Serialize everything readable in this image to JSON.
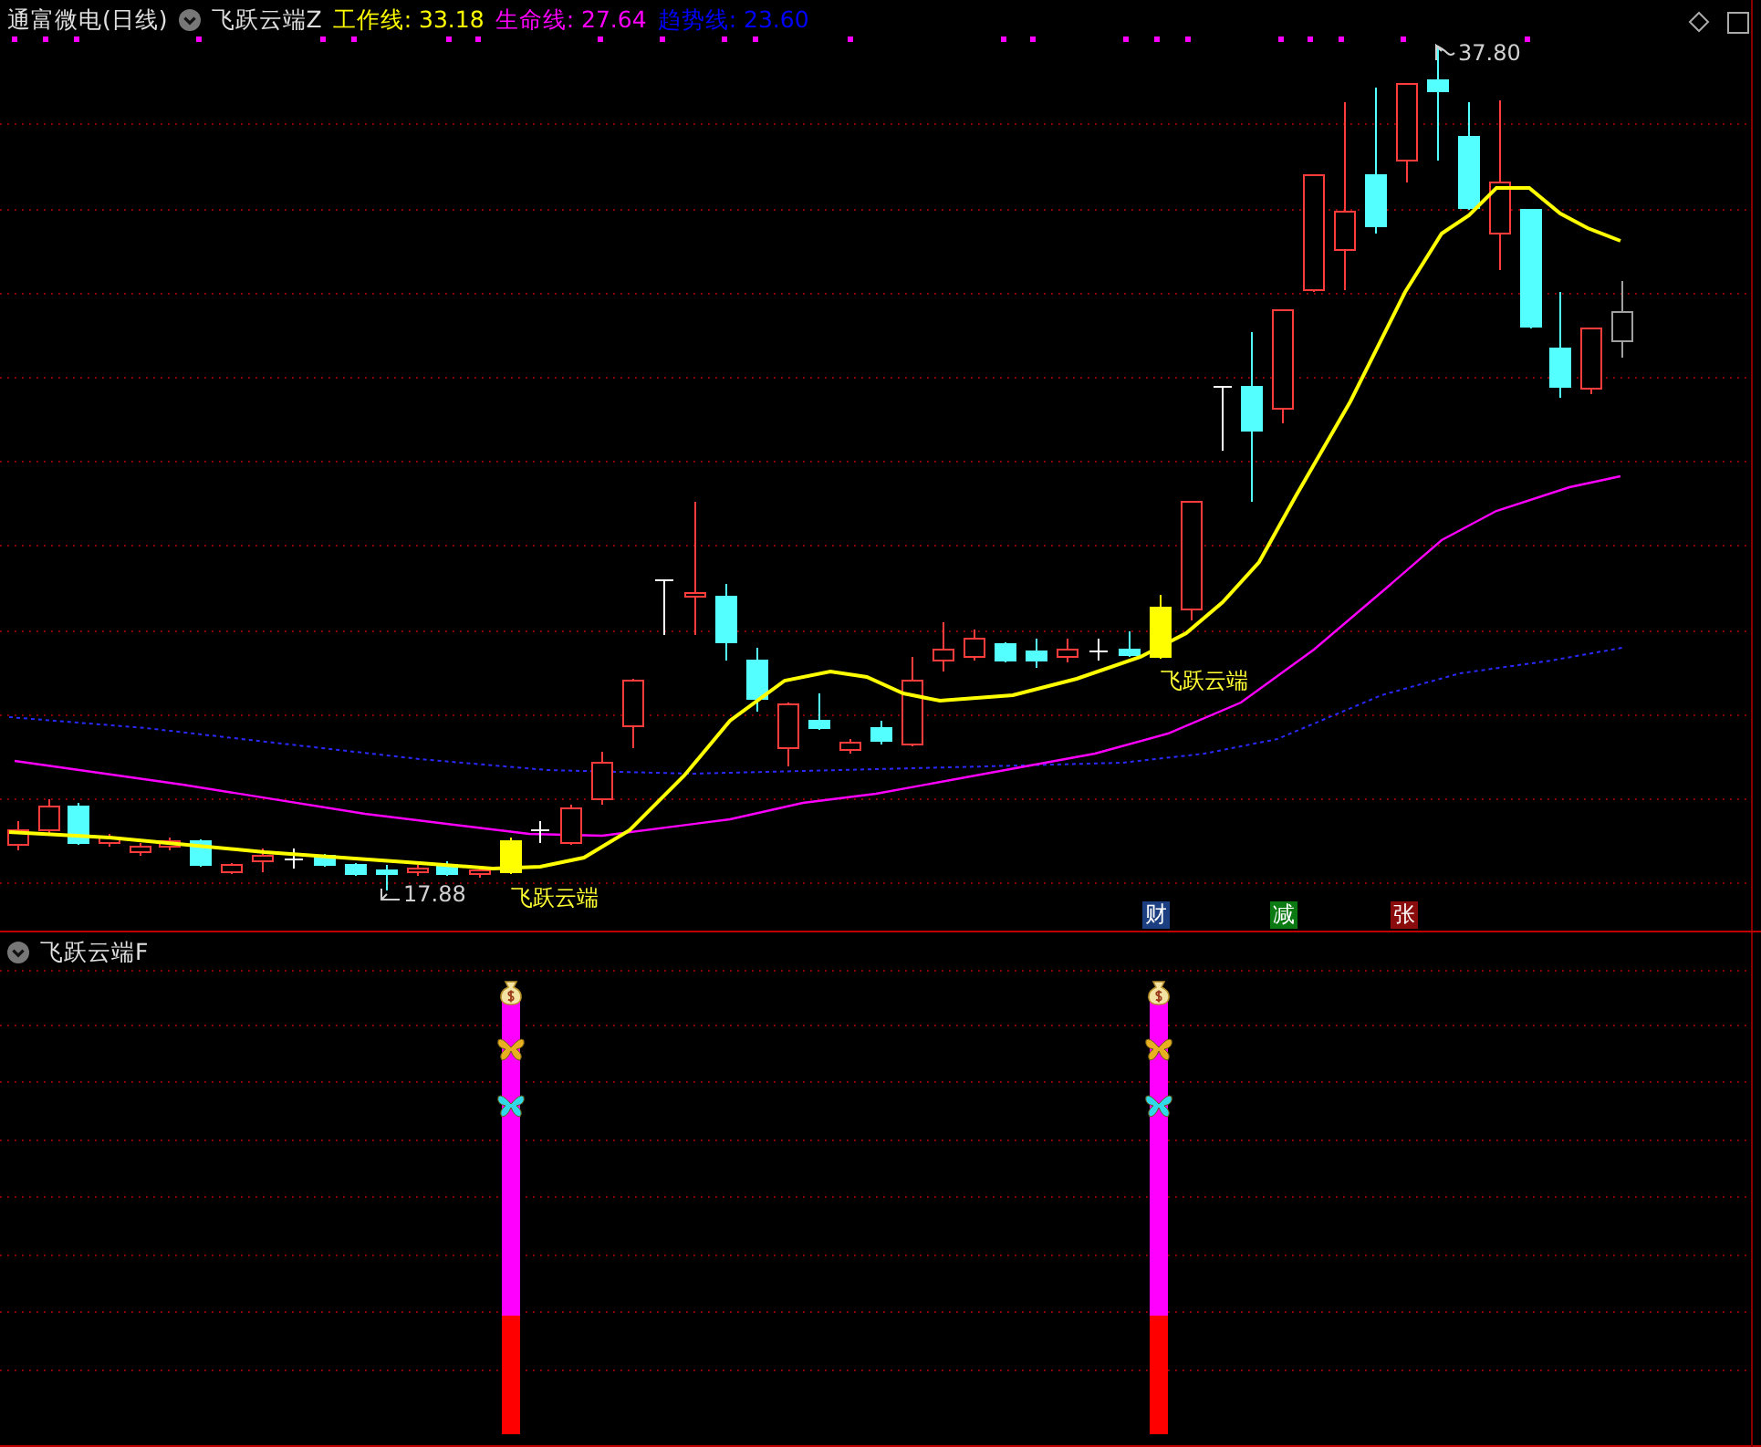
{
  "header": {
    "title": "通富微电(日线)",
    "indicator": "飞跃云端Z",
    "legend": [
      {
        "label": "工作线: 33.18",
        "color": "#ffff00"
      },
      {
        "label": "生命线: 27.64",
        "color": "#ff00ff"
      },
      {
        "label": "趋势线: 23.60",
        "color": "#0000ff"
      }
    ]
  },
  "price_marks": [
    {
      "kind": "low",
      "text": "17.88"
    },
    {
      "kind": "high",
      "text": "37.80"
    }
  ],
  "signal_labels": [
    "飞跃云端",
    "飞跃云端"
  ],
  "markers": [
    {
      "text": "财",
      "color": "#1c3f82"
    },
    {
      "text": "减",
      "color": "#0b7a12"
    },
    {
      "text": "张",
      "color": "#8a0c0c"
    }
  ],
  "sub_panel": {
    "title": "飞跃云端F"
  }
}
